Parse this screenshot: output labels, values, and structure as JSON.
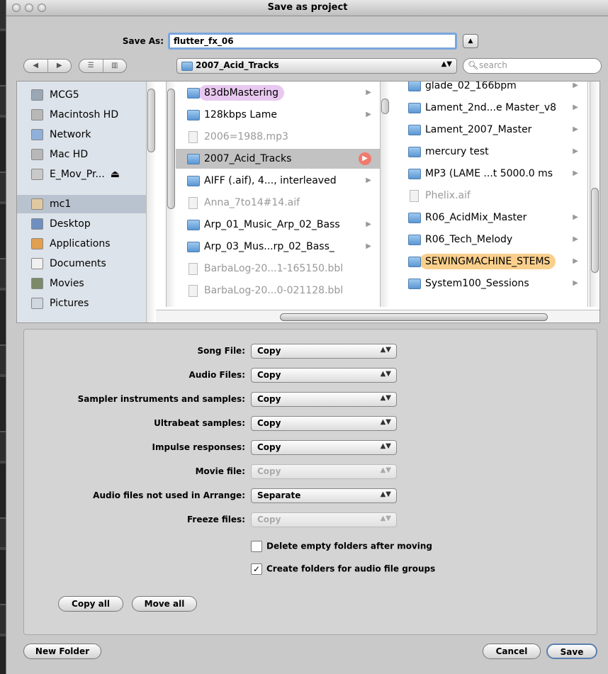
{
  "window": {
    "title": "Save as project"
  },
  "save_as": {
    "label": "Save As:",
    "value": "flutter_fx_06"
  },
  "path_popup": {
    "value": "2007_Acid_Tracks"
  },
  "search": {
    "placeholder": "search"
  },
  "sidebar": {
    "items": [
      {
        "label": "MCG5",
        "icon": "computer-icon"
      },
      {
        "label": "Macintosh HD",
        "icon": "harddisk-icon"
      },
      {
        "label": "Network",
        "icon": "network-icon"
      },
      {
        "label": "Mac HD",
        "icon": "harddisk-icon"
      },
      {
        "label": "E_Mov_Pr...",
        "icon": "disk-icon",
        "eject": "⏏"
      },
      {
        "label": "mc1",
        "icon": "home-icon"
      },
      {
        "label": "Desktop",
        "icon": "desktop-icon"
      },
      {
        "label": "Applications",
        "icon": "applications-icon"
      },
      {
        "label": "Documents",
        "icon": "documents-icon"
      },
      {
        "label": "Movies",
        "icon": "movies-icon"
      },
      {
        "label": "Pictures",
        "icon": "pictures-icon"
      }
    ]
  },
  "column1": [
    {
      "label": "83dbMastering",
      "type": "folder",
      "label_color": "#e8c8f0"
    },
    {
      "label": "128kbps Lame",
      "type": "folder"
    },
    {
      "label": "2006=1988.mp3",
      "type": "file"
    },
    {
      "label": "2007_Acid_Tracks",
      "type": "folder",
      "selected": true
    },
    {
      "label": "AIFF (.aif), 4..., interleaved",
      "type": "folder"
    },
    {
      "label": "Anna_7to14#14.aif",
      "type": "file"
    },
    {
      "label": "Arp_01_Music_Arp_02_Bass",
      "type": "folder"
    },
    {
      "label": "Arp_03_Mus...rp_02_Bass_",
      "type": "folder"
    },
    {
      "label": "BarbaLog-20...1-165150.bbl",
      "type": "file"
    },
    {
      "label": "BarbaLog-20...0-021128.bbl",
      "type": "file"
    }
  ],
  "column2": [
    {
      "label": "glade_02_166bpm",
      "type": "folder"
    },
    {
      "label": "Lament_2nd...e Master_v8",
      "type": "folder"
    },
    {
      "label": "Lament_2007_Master",
      "type": "folder"
    },
    {
      "label": "mercury test",
      "type": "folder"
    },
    {
      "label": "MP3 (LAME ...t 5000.0 ms",
      "type": "folder"
    },
    {
      "label": "Phelix.aif",
      "type": "file"
    },
    {
      "label": "R06_AcidMix_Master",
      "type": "folder"
    },
    {
      "label": "R06_Tech_Melody",
      "type": "folder"
    },
    {
      "label": "SEWINGMACHINE_STEMS",
      "type": "folder",
      "label_color": "#f9cf8c"
    },
    {
      "label": "System100_Sessions",
      "type": "folder"
    }
  ],
  "options": [
    {
      "label": "Song File:",
      "value": "Copy",
      "enabled": true
    },
    {
      "label": "Audio Files:",
      "value": "Copy",
      "enabled": true
    },
    {
      "label": "Sampler instruments and samples:",
      "value": "Copy",
      "enabled": true
    },
    {
      "label": "Ultrabeat samples:",
      "value": "Copy",
      "enabled": true
    },
    {
      "label": "Impulse responses:",
      "value": "Copy",
      "enabled": true
    },
    {
      "label": "Movie file:",
      "value": "Copy",
      "enabled": false
    },
    {
      "label": "Audio files not used in Arrange:",
      "value": "Separate",
      "enabled": true
    },
    {
      "label": "Freeze files:",
      "value": "Copy",
      "enabled": false
    }
  ],
  "checkboxes": [
    {
      "label": "Delete empty folders after moving",
      "checked": false,
      "mark": ""
    },
    {
      "label": "Create folders for audio file groups",
      "checked": true,
      "mark": "✓"
    }
  ],
  "buttons": {
    "copy_all": "Copy all",
    "move_all": "Move all",
    "new_folder": "New Folder",
    "cancel": "Cancel",
    "save": "Save"
  },
  "colors": {
    "focus_ring": "#7aa6dc",
    "sidebar_bg": "#dde3ea",
    "selected_arrow": "#f07a6e"
  }
}
